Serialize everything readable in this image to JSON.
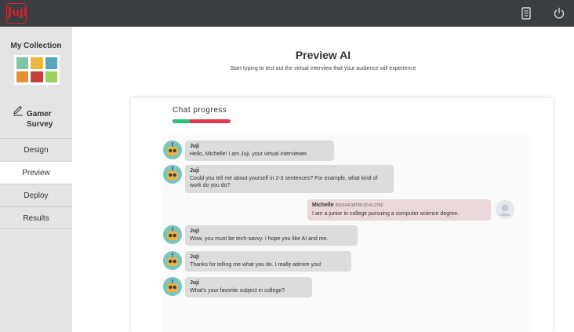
{
  "app": {
    "logo_text": "Juji"
  },
  "topbar": {
    "icons": [
      "document-icon",
      "power-icon"
    ]
  },
  "sidebar": {
    "collection_title": "My Collection",
    "survey_name": "Gamer Survey",
    "nav": [
      "Design",
      "Preview",
      "Deploy",
      "Results"
    ],
    "active": "Preview"
  },
  "main": {
    "title": "Preview AI",
    "subtitle": "Start typing to test out the virtual interview that your audience will experience"
  },
  "chat": {
    "progress_label": "Chat progress",
    "progress_fraction": 0.3,
    "colors": {
      "progress_done": "#2ac37e",
      "progress_remaining": "#dc3a4c"
    },
    "messages": [
      {
        "sender": "Juji",
        "role": "bot",
        "text": "Hello, Michelle! I am Juji, your virtual interviewer."
      },
      {
        "sender": "Juji",
        "role": "bot",
        "text": "Could you tell me about yourself in 2-3 sentences? For example, what kind of work do you do?"
      },
      {
        "sender": "Michelle",
        "role": "user",
        "timestamp": "2019-04-18T06:22:41.275Z",
        "text": "I am a junior in college pursuing a computer science degree."
      },
      {
        "sender": "Juji",
        "role": "bot",
        "text": "Wow, you must be tech-savvy. I hope you like AI and me."
      },
      {
        "sender": "Juji",
        "role": "bot",
        "text": "Thanks for telling me what you do. I really admire you!"
      },
      {
        "sender": "Juji",
        "role": "bot",
        "text": "What's your favorite subject in college?"
      }
    ]
  }
}
